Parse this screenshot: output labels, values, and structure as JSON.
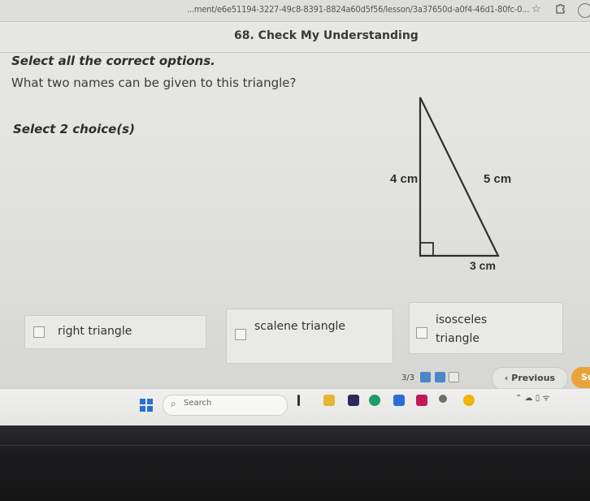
{
  "browser": {
    "url": "...ment/e6e51194-3227-49c8-8391-8824a60d5f56/lesson/3a37650d-a0f4-46d1-80fc-0..."
  },
  "header": {
    "title": "68. Check My Understanding"
  },
  "question": {
    "instruction": "Select all the correct options.",
    "prompt": "What two names can be given to this triangle?",
    "select_count": "Select 2 choice(s)"
  },
  "figure": {
    "side_left": "4 cm",
    "side_hyp": "5 cm",
    "side_bottom": "3 cm"
  },
  "choices": [
    {
      "label": "right triangle"
    },
    {
      "label": "scalene triangle"
    },
    {
      "label": "isosceles triangle"
    }
  ],
  "footer": {
    "progress": "3/3",
    "previous_label": "Previous",
    "next_label": "Su"
  },
  "taskbar": {
    "search_label": "Search",
    "colors": {
      "start": "#2a6fd6",
      "next": "#e8a43a"
    }
  }
}
